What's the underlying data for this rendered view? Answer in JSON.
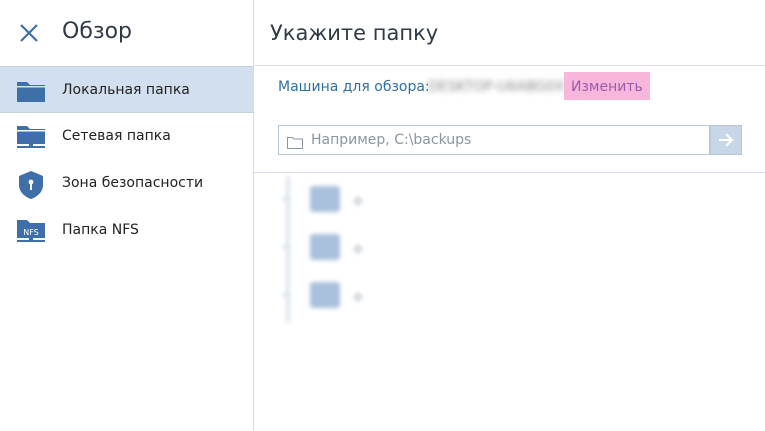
{
  "sidebar": {
    "title": "Обзор",
    "items": [
      {
        "label": "Локальная папка",
        "icon": "local-folder-icon",
        "active": true
      },
      {
        "label": "Сетевая папка",
        "icon": "network-folder-icon",
        "active": false
      },
      {
        "label": "Зона безопасности",
        "icon": "shield-icon",
        "active": false
      },
      {
        "label": "Папка NFS",
        "icon": "nfs-folder-icon",
        "active": false
      }
    ]
  },
  "main": {
    "title": "Укажите папку",
    "machine_label": "Машина для обзора:",
    "machine_name": "DESKTOP-U6ABG0X",
    "change_label": "Изменить",
    "path_placeholder": "Например, C:\\backups",
    "path_value": ""
  },
  "colors": {
    "accent": "#2e6fa8",
    "active_item_bg": "#d2dfee",
    "highlight": "#f7b6da",
    "icon_blue": "#3f6fa8"
  }
}
